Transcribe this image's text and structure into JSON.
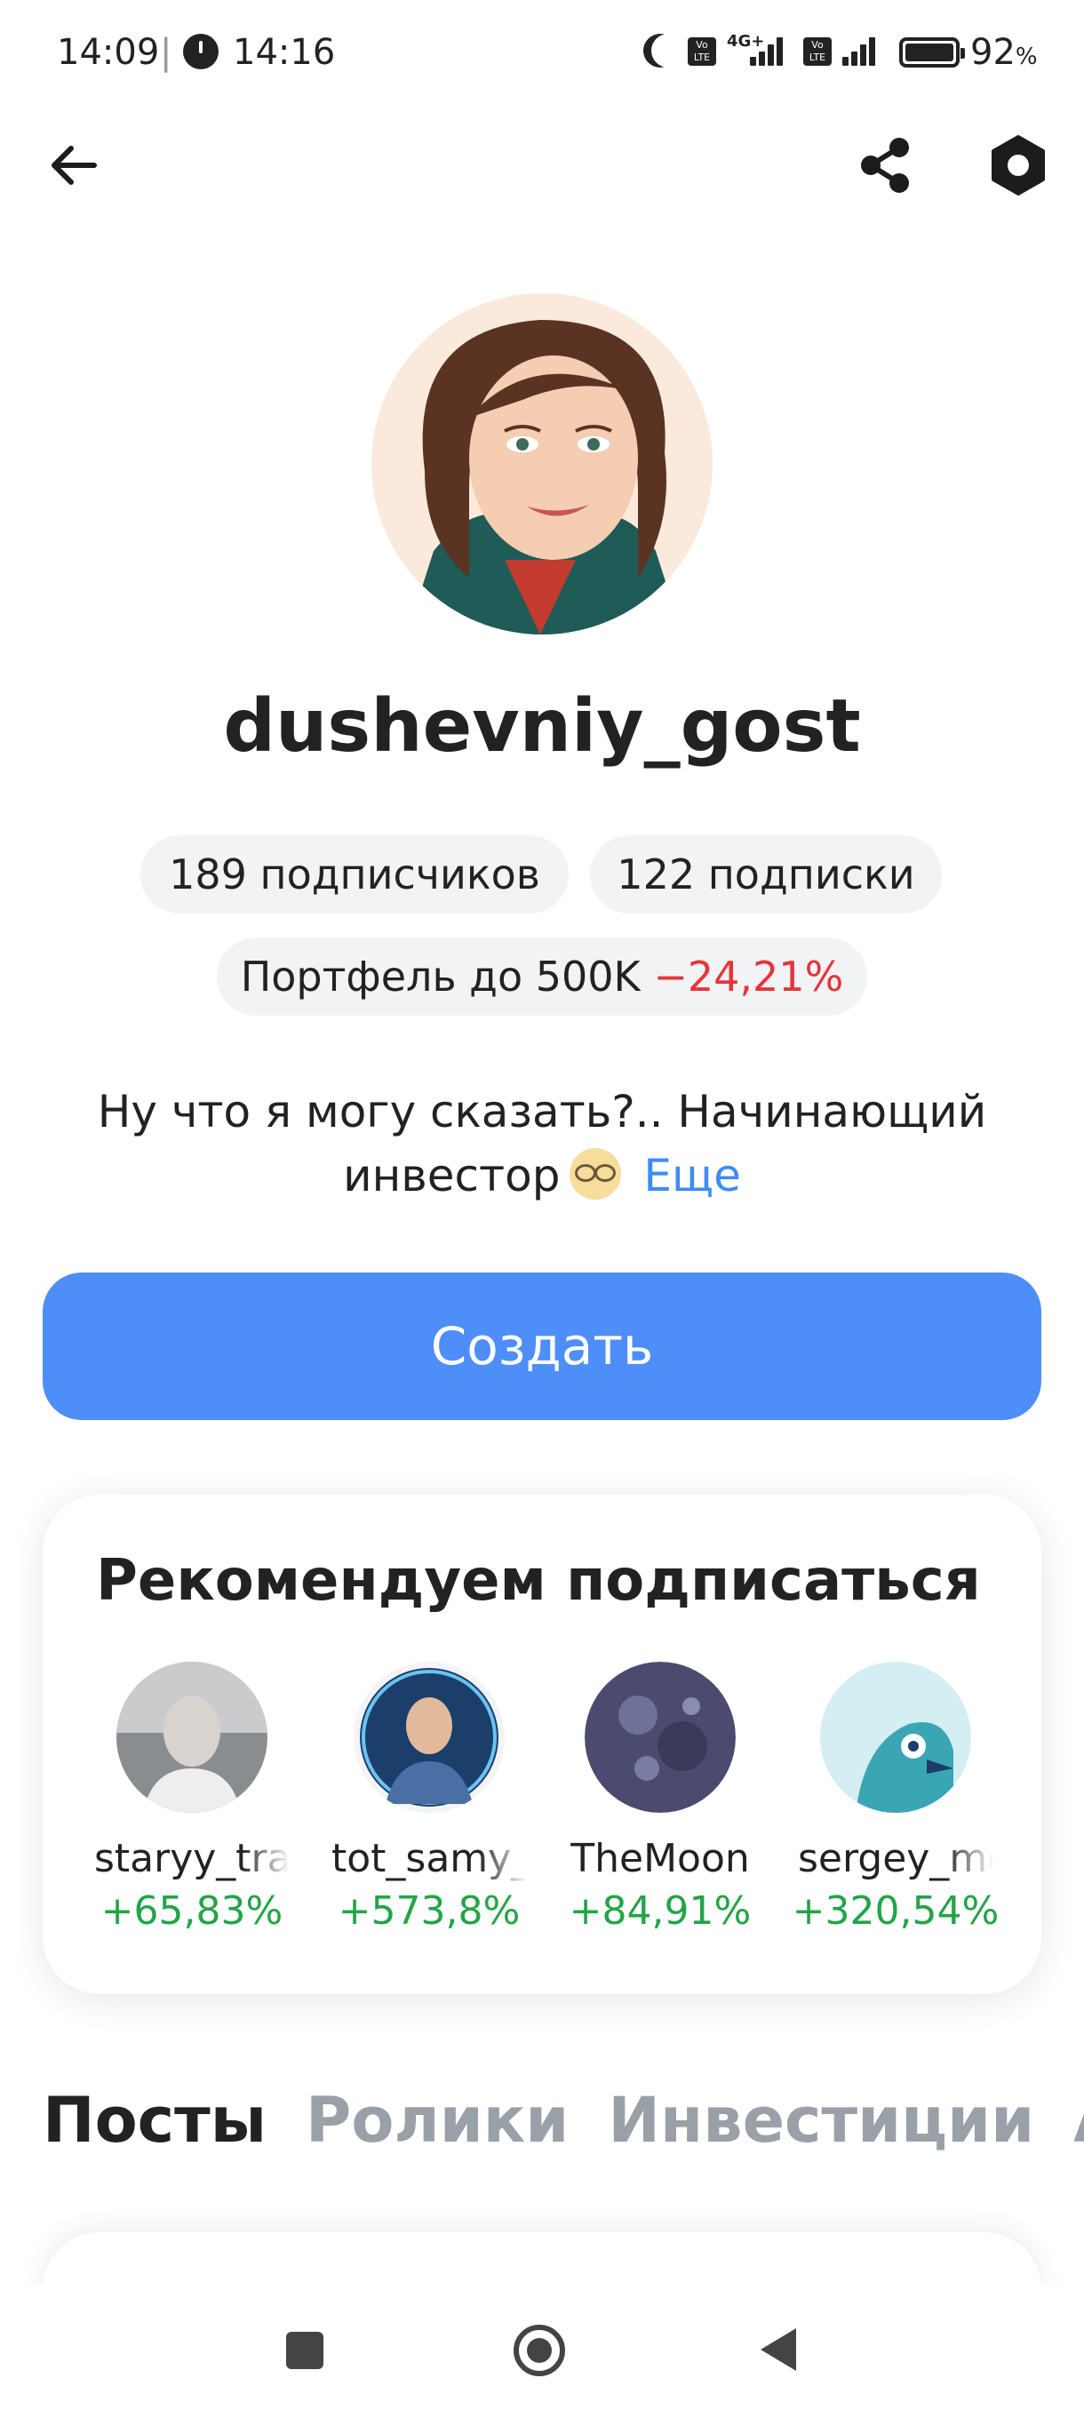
{
  "status_bar": {
    "time": "14:09",
    "separator": "|",
    "clock_time": "14:16",
    "lte_label": "Vo LTE",
    "network": "4G+",
    "battery": "92",
    "battery_unit": "%"
  },
  "profile": {
    "username": "dushevniy_gost",
    "followers": "189 подписчиков",
    "following": "122 подписки",
    "portfolio_label": "Портфель до 500K",
    "portfolio_change": "−24,21%",
    "bio_line1": "Ну что я могу сказать?.. Начинающий",
    "bio_line2": "инвестор",
    "bio_more": "Еще"
  },
  "create_button": "Создать",
  "recommend": {
    "title": "Рекомендуем подписаться",
    "items": [
      {
        "name": "staryy_trader",
        "change": "+65,83%"
      },
      {
        "name": "tot_samy_",
        "change": "+573,8%"
      },
      {
        "name": "TheMoon",
        "change": "+84,91%"
      },
      {
        "name": "sergey_mo",
        "change": "+320,54%"
      }
    ]
  },
  "tabs": [
    "Посты",
    "Ролики",
    "Инвестиции",
    "Акти"
  ],
  "colors": {
    "accent": "#4d8ef8",
    "negative": "#e63539",
    "positive": "#22a547",
    "link": "#3d8cf6"
  },
  "icons": {
    "back": "arrow-left-icon",
    "share": "share-icon",
    "settings": "hexagon-settings-icon"
  }
}
